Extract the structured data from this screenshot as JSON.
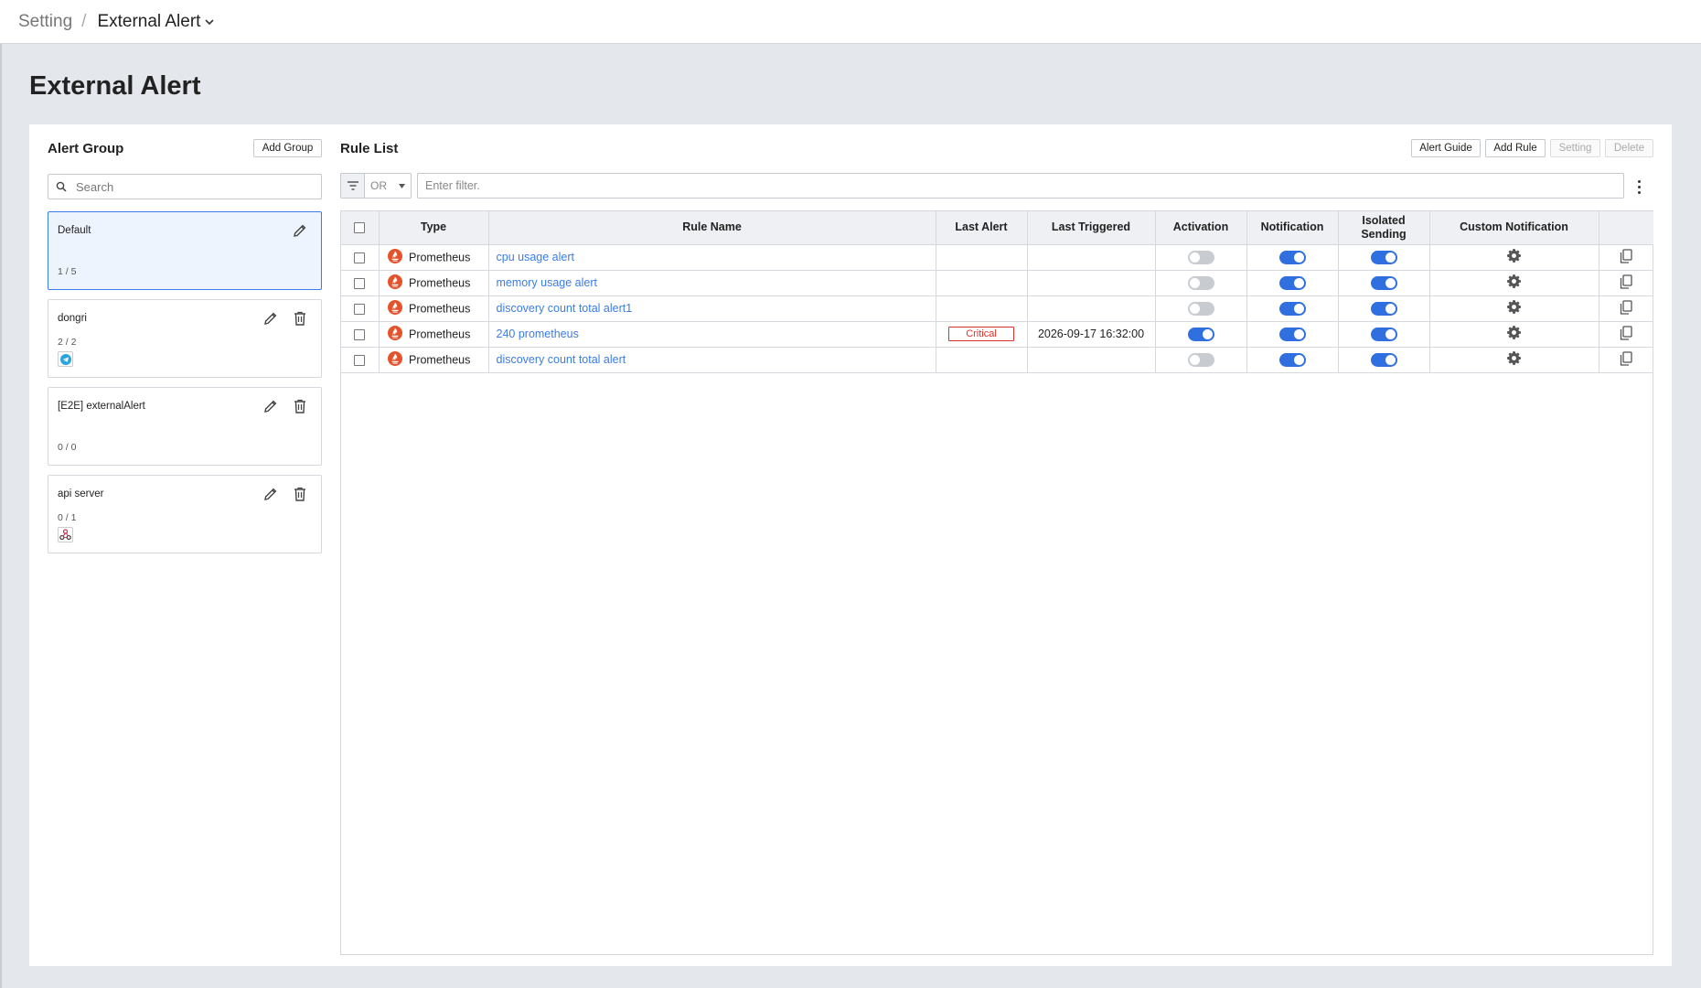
{
  "breadcrumb": {
    "root": "Setting",
    "separator": "/",
    "current": "External Alert"
  },
  "page_title": "External Alert",
  "alert_group": {
    "title": "Alert Group",
    "add_button": "Add Group",
    "search_placeholder": "Search",
    "groups": [
      {
        "name": "Default",
        "count": "1 / 5",
        "selected": true,
        "badge": ""
      },
      {
        "name": "dongri",
        "count": "2 / 2",
        "selected": false,
        "badge": "telegram-icon"
      },
      {
        "name": "[E2E] externalAlert",
        "count": "0 / 0",
        "selected": false,
        "badge": ""
      },
      {
        "name": "api server",
        "count": "0 / 1",
        "selected": false,
        "badge": "webhook-icon"
      }
    ]
  },
  "rule_list": {
    "title": "Rule List",
    "buttons": {
      "alert_guide": "Alert Guide",
      "add_rule": "Add Rule",
      "setting": "Setting",
      "delete": "Delete"
    },
    "filter": {
      "operator": "OR",
      "placeholder": "Enter filter."
    },
    "columns": {
      "type": "Type",
      "rule_name": "Rule Name",
      "last_alert": "Last Alert",
      "last_triggered": "Last Triggered",
      "activation": "Activation",
      "notification": "Notification",
      "isolated_1": "Isolated",
      "isolated_2": "Sending",
      "custom_notification": "Custom Notification"
    },
    "rows": [
      {
        "type": "Prometheus",
        "name": "cpu usage alert",
        "last_alert": "",
        "last_triggered": "",
        "activation": false,
        "notification": true,
        "isolated": true
      },
      {
        "type": "Prometheus",
        "name": "memory usage alert",
        "last_alert": "",
        "last_triggered": "",
        "activation": false,
        "notification": true,
        "isolated": true
      },
      {
        "type": "Prometheus",
        "name": "discovery count total alert1",
        "last_alert": "",
        "last_triggered": "",
        "activation": false,
        "notification": true,
        "isolated": true
      },
      {
        "type": "Prometheus",
        "name": "240 prometheus",
        "last_alert": "Critical",
        "last_triggered": "2026-09-17 16:32:00",
        "activation": true,
        "notification": true,
        "isolated": true
      },
      {
        "type": "Prometheus",
        "name": "discovery count total alert",
        "last_alert": "",
        "last_triggered": "",
        "activation": false,
        "notification": true,
        "isolated": true
      }
    ]
  },
  "colors": {
    "accent": "#2f6fe0",
    "link": "#3b7de9",
    "critical": "#d9342b",
    "prometheus": "#e6522c"
  }
}
